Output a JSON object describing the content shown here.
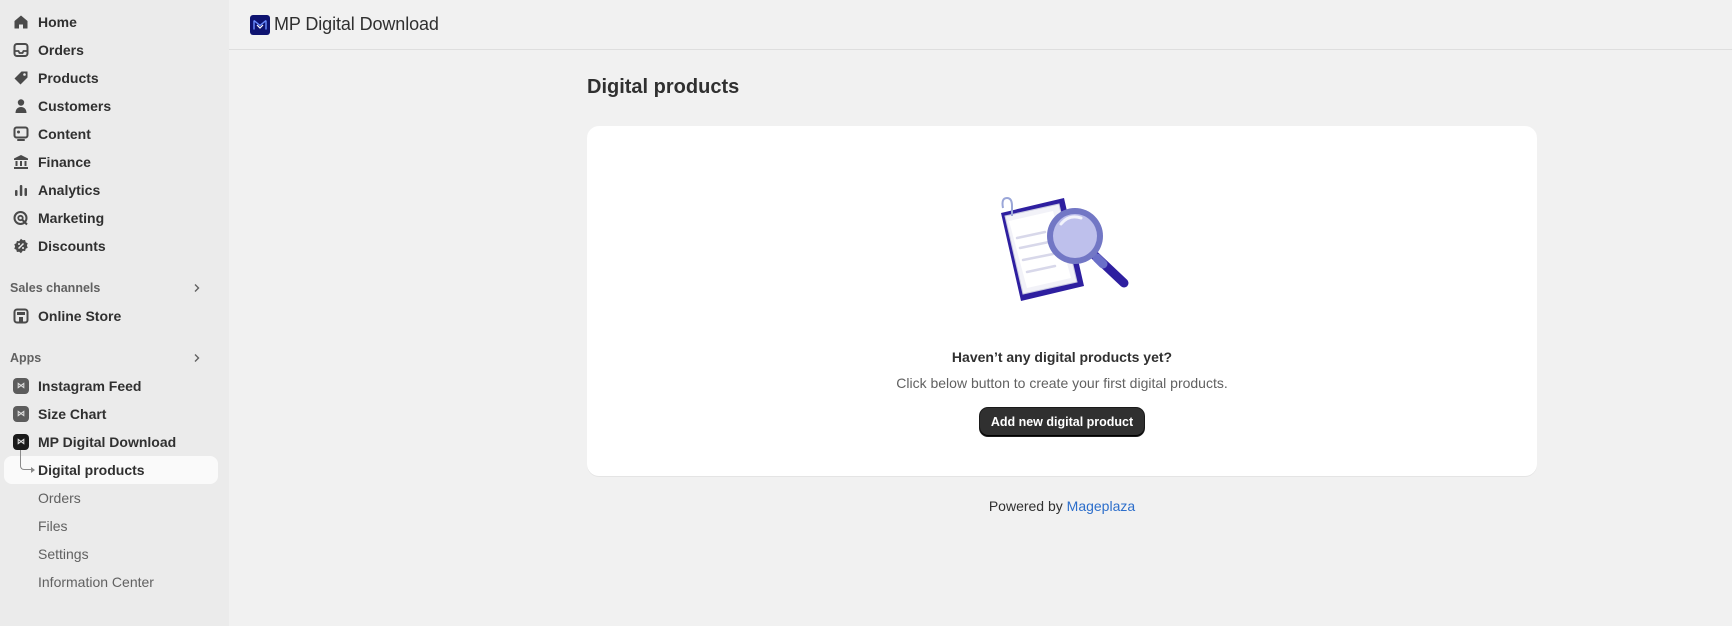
{
  "sidebar": {
    "items": [
      {
        "label": "Home",
        "icon": "home-icon"
      },
      {
        "label": "Orders",
        "icon": "inbox-icon"
      },
      {
        "label": "Products",
        "icon": "tag-icon"
      },
      {
        "label": "Customers",
        "icon": "person-icon"
      },
      {
        "label": "Content",
        "icon": "content-icon"
      },
      {
        "label": "Finance",
        "icon": "bank-icon"
      },
      {
        "label": "Analytics",
        "icon": "bar-chart-icon"
      },
      {
        "label": "Marketing",
        "icon": "target-icon"
      },
      {
        "label": "Discounts",
        "icon": "discount-icon"
      }
    ],
    "sales_channels": {
      "heading": "Sales channels",
      "items": [
        {
          "label": "Online Store",
          "icon": "store-icon"
        }
      ]
    },
    "apps": {
      "heading": "Apps",
      "items": [
        {
          "label": "Instagram Feed",
          "icon": "app-icon"
        },
        {
          "label": "Size Chart",
          "icon": "app-icon"
        },
        {
          "label": "MP Digital Download",
          "icon": "app-icon"
        }
      ],
      "sub_items": [
        {
          "label": "Digital products",
          "active": true
        },
        {
          "label": "Orders"
        },
        {
          "label": "Files"
        },
        {
          "label": "Settings"
        },
        {
          "label": "Information Center"
        }
      ]
    }
  },
  "header": {
    "app_title": "MP Digital Download",
    "logo_color": "#0e1370"
  },
  "main": {
    "page_title": "Digital products",
    "empty_state": {
      "title": "Haven’t any digital products yet?",
      "description": "Click below button to create your first digital products.",
      "button_label": "Add new digital product"
    },
    "footer": {
      "prefix": "Powered by",
      "link_text": "Mageplaza"
    }
  },
  "colors": {
    "accent_link": "#2c6ecb",
    "illustration_primary": "#2e1fa0",
    "primary_button": "#303030"
  }
}
